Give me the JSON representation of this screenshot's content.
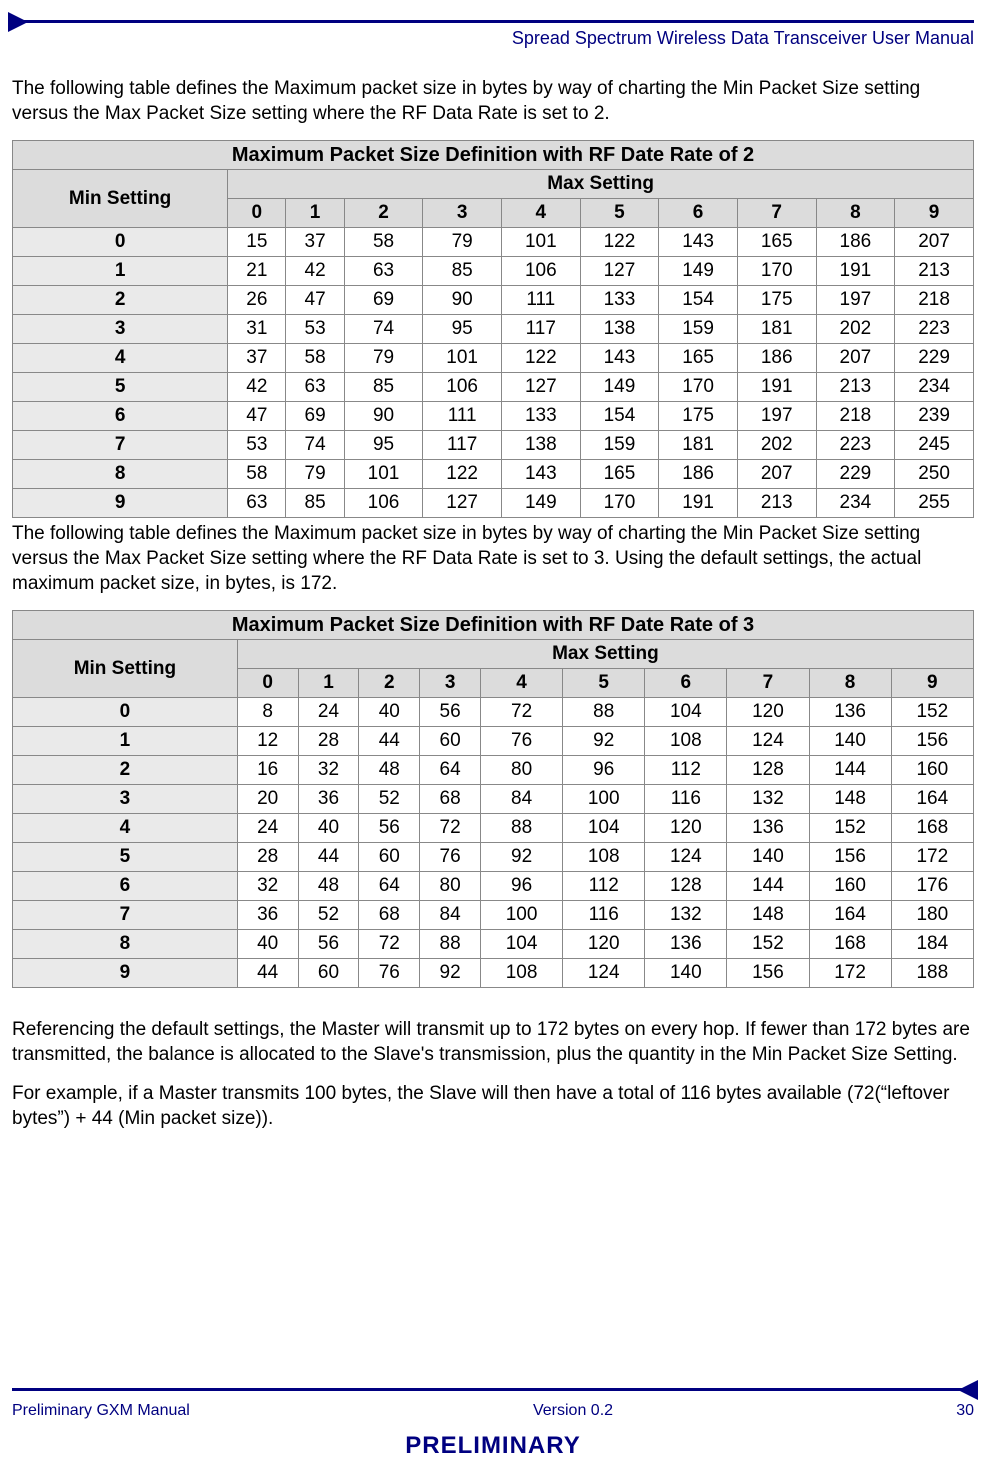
{
  "header": {
    "doc_title": "Spread Spectrum Wireless Data Transceiver User Manual"
  },
  "watermark": "PRELIMINARY",
  "para1": "The following table defines the Maximum packet size in bytes by way of charting the Min Packet Size setting versus the Max Packet Size setting where the RF Data Rate is set to 2.",
  "table1": {
    "title": "Maximum Packet Size Definition with RF Date Rate of 2",
    "max_setting_label": "Max Setting",
    "min_setting_label": "Min Setting",
    "col_headers": [
      "0",
      "1",
      "2",
      "3",
      "4",
      "5",
      "6",
      "7",
      "8",
      "9"
    ],
    "rows": [
      {
        "h": "0",
        "v": [
          "15",
          "37",
          "58",
          "79",
          "101",
          "122",
          "143",
          "165",
          "186",
          "207"
        ]
      },
      {
        "h": "1",
        "v": [
          "21",
          "42",
          "63",
          "85",
          "106",
          "127",
          "149",
          "170",
          "191",
          "213"
        ]
      },
      {
        "h": "2",
        "v": [
          "26",
          "47",
          "69",
          "90",
          "111",
          "133",
          "154",
          "175",
          "197",
          "218"
        ]
      },
      {
        "h": "3",
        "v": [
          "31",
          "53",
          "74",
          "95",
          "117",
          "138",
          "159",
          "181",
          "202",
          "223"
        ]
      },
      {
        "h": "4",
        "v": [
          "37",
          "58",
          "79",
          "101",
          "122",
          "143",
          "165",
          "186",
          "207",
          "229"
        ]
      },
      {
        "h": "5",
        "v": [
          "42",
          "63",
          "85",
          "106",
          "127",
          "149",
          "170",
          "191",
          "213",
          "234"
        ]
      },
      {
        "h": "6",
        "v": [
          "47",
          "69",
          "90",
          "111",
          "133",
          "154",
          "175",
          "197",
          "218",
          "239"
        ]
      },
      {
        "h": "7",
        "v": [
          "53",
          "74",
          "95",
          "117",
          "138",
          "159",
          "181",
          "202",
          "223",
          "245"
        ]
      },
      {
        "h": "8",
        "v": [
          "58",
          "79",
          "101",
          "122",
          "143",
          "165",
          "186",
          "207",
          "229",
          "250"
        ]
      },
      {
        "h": "9",
        "v": [
          "63",
          "85",
          "106",
          "127",
          "149",
          "170",
          "191",
          "213",
          "234",
          "255"
        ]
      }
    ]
  },
  "para2": "The following table defines the Maximum packet size in bytes by way of charting the Min Packet Size setting versus the Max Packet Size setting where the RF Data Rate is set to 3.  Using the default settings, the actual maximum packet size, in bytes, is 172.",
  "table2": {
    "title": "Maximum Packet Size Definition with RF Date Rate of 3",
    "max_setting_label": "Max Setting",
    "min_setting_label": "Min Setting",
    "col_headers": [
      "0",
      "1",
      "2",
      "3",
      "4",
      "5",
      "6",
      "7",
      "8",
      "9"
    ],
    "rows": [
      {
        "h": "0",
        "v": [
          "8",
          "24",
          "40",
          "56",
          "72",
          "88",
          "104",
          "120",
          "136",
          "152"
        ]
      },
      {
        "h": "1",
        "v": [
          "12",
          "28",
          "44",
          "60",
          "76",
          "92",
          "108",
          "124",
          "140",
          "156"
        ]
      },
      {
        "h": "2",
        "v": [
          "16",
          "32",
          "48",
          "64",
          "80",
          "96",
          "112",
          "128",
          "144",
          "160"
        ]
      },
      {
        "h": "3",
        "v": [
          "20",
          "36",
          "52",
          "68",
          "84",
          "100",
          "116",
          "132",
          "148",
          "164"
        ]
      },
      {
        "h": "4",
        "v": [
          "24",
          "40",
          "56",
          "72",
          "88",
          "104",
          "120",
          "136",
          "152",
          "168"
        ]
      },
      {
        "h": "5",
        "v": [
          "28",
          "44",
          "60",
          "76",
          "92",
          "108",
          "124",
          "140",
          "156",
          "172"
        ]
      },
      {
        "h": "6",
        "v": [
          "32",
          "48",
          "64",
          "80",
          "96",
          "112",
          "128",
          "144",
          "160",
          "176"
        ]
      },
      {
        "h": "7",
        "v": [
          "36",
          "52",
          "68",
          "84",
          "100",
          "116",
          "132",
          "148",
          "164",
          "180"
        ]
      },
      {
        "h": "8",
        "v": [
          "40",
          "56",
          "72",
          "88",
          "104",
          "120",
          "136",
          "152",
          "168",
          "184"
        ]
      },
      {
        "h": "9",
        "v": [
          "44",
          "60",
          "76",
          "92",
          "108",
          "124",
          "140",
          "156",
          "172",
          "188"
        ]
      }
    ]
  },
  "para3": "Referencing the default settings, the Master will transmit up to 172 bytes on every hop. If fewer than 172 bytes are transmitted, the balance is allocated to the Slave's transmission, plus the quantity in the Min Packet Size Setting.",
  "para4": "For example, if a Master transmits 100 bytes, the Slave will then have a total of 116 bytes available (72(“leftover bytes”) + 44 (Min packet size)).",
  "footer": {
    "left": "Preliminary GXM Manual",
    "center": "Version 0.2",
    "right": "30",
    "preliminary": "PRELIMINARY"
  }
}
